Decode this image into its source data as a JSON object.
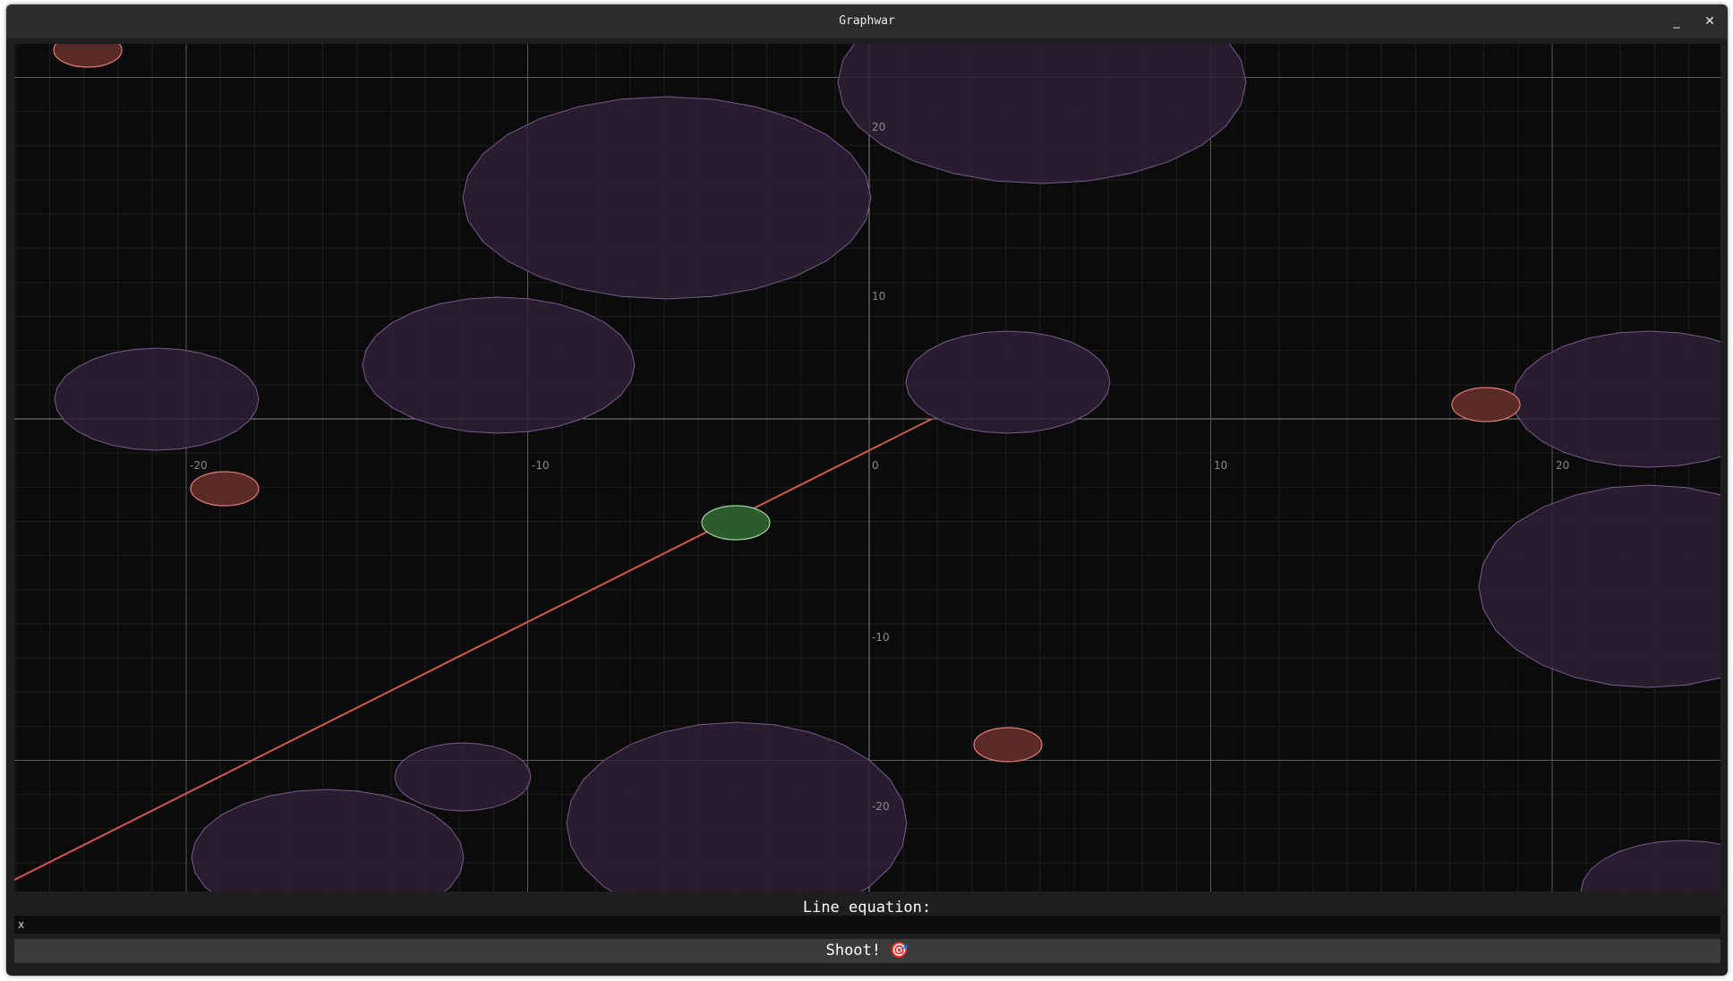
{
  "window": {
    "title": "Graphwar",
    "minimize_label": "_",
    "close_label": "✕"
  },
  "graph": {
    "x_ticks": [
      "-20",
      "-10",
      "0",
      "10",
      "20"
    ],
    "y_ticks": [
      "20",
      "10",
      "-10",
      "-20"
    ],
    "colors": {
      "background": "#0b0b0b",
      "minor_grid": "#1f1f1f",
      "major_grid": "#5a5a5a",
      "axis": "#8a8a8a",
      "obstacle_fill": "#2e2036",
      "obstacle_stroke": "#7a5a8e",
      "enemy_fill": "#5a2a28",
      "enemy_stroke": "#e07a70",
      "player_fill": "#2e5a30",
      "player_stroke": "#9ad49a",
      "shot_line": "#d05a4e"
    }
  },
  "controls": {
    "equation_label": "Line equation:",
    "equation_value": "x",
    "shoot_label": "Shoot! 🎯"
  }
}
